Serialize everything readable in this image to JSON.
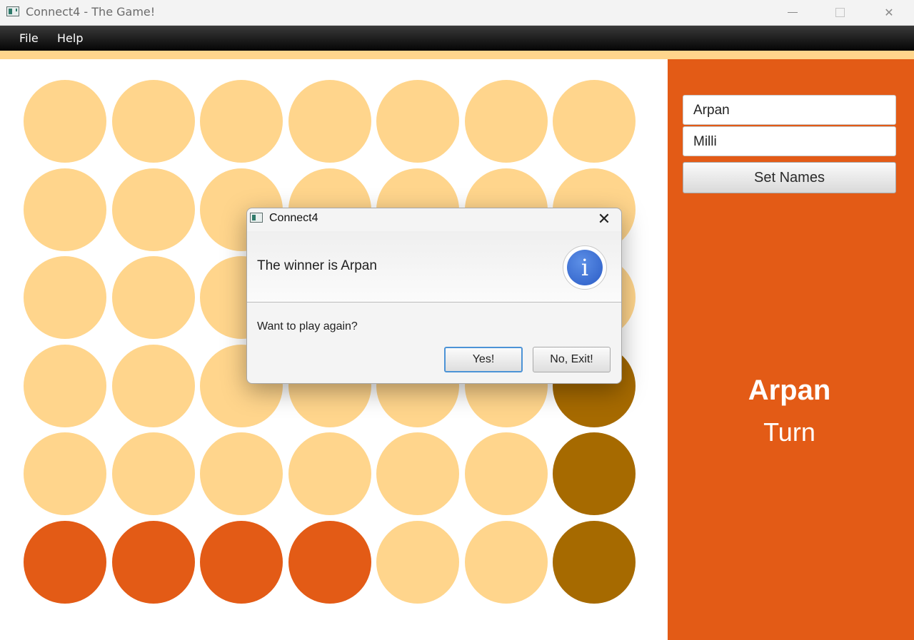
{
  "window": {
    "title": "Connect4 - The Game!"
  },
  "menu": {
    "items": [
      "File",
      "Help"
    ]
  },
  "colors": {
    "empty": "#ffd58c",
    "player1": "#e35b16",
    "player2": "#a66a00",
    "panel": "#e35b16"
  },
  "board": {
    "rows": 6,
    "cols": 7,
    "cells": [
      [
        "empty",
        "empty",
        "empty",
        "empty",
        "empty",
        "empty",
        "empty"
      ],
      [
        "empty",
        "empty",
        "empty",
        "empty",
        "empty",
        "empty",
        "empty"
      ],
      [
        "empty",
        "empty",
        "empty",
        "empty",
        "empty",
        "empty",
        "empty"
      ],
      [
        "empty",
        "empty",
        "empty",
        "empty",
        "empty",
        "empty",
        "player2"
      ],
      [
        "empty",
        "empty",
        "empty",
        "empty",
        "empty",
        "empty",
        "player2"
      ],
      [
        "player1",
        "player1",
        "player1",
        "player1",
        "empty",
        "empty",
        "player2"
      ]
    ]
  },
  "side_panel": {
    "player1_name": "Arpan",
    "player2_name": "Milli",
    "set_names_label": "Set Names",
    "current_player": "Arpan",
    "turn_label": "Turn"
  },
  "dialog": {
    "title": "Connect4",
    "close_glyph": "✕",
    "header_text": "The winner is Arpan",
    "info_glyph": "i",
    "content_text": "Want to play again?",
    "yes_label": "Yes!",
    "no_label": "No, Exit!"
  }
}
